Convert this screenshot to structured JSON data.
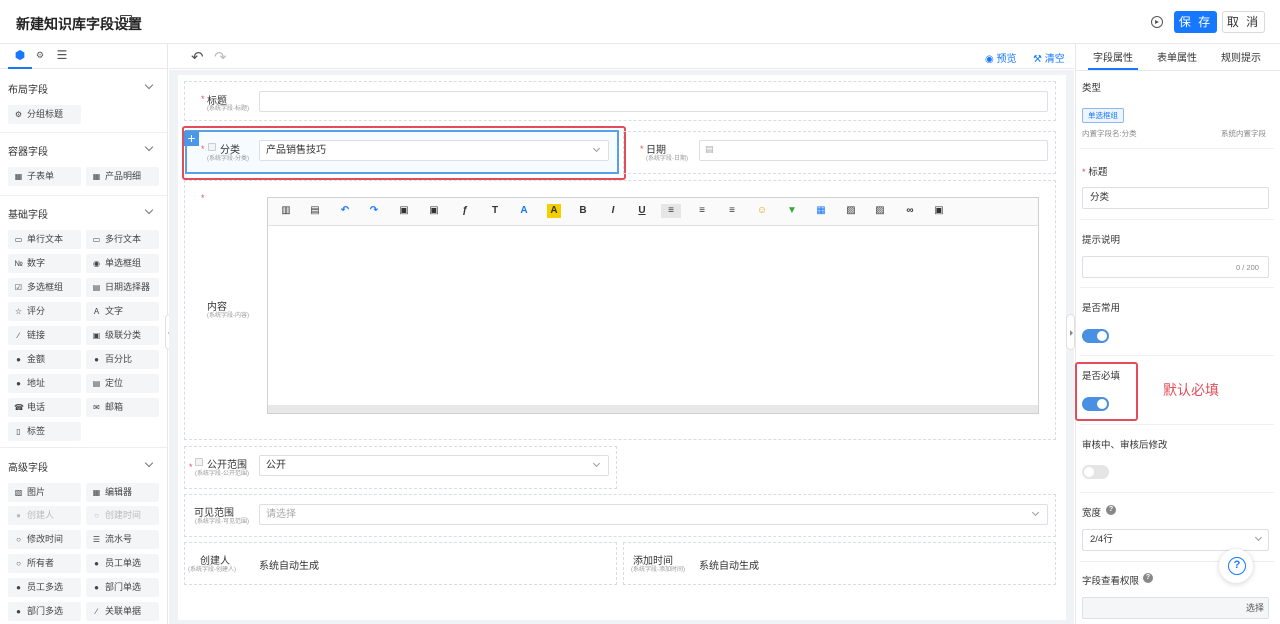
{
  "header": {
    "title": "新建知识库字段设置",
    "save_label": "保 存",
    "cancel_label": "取 消"
  },
  "left_panel": {
    "sections": [
      {
        "title": "布局字段",
        "items": [
          {
            "label": "分组标题",
            "icon": "group-title-icon"
          }
        ]
      },
      {
        "title": "容器字段",
        "items": [
          {
            "label": "子表单",
            "icon": "table-icon"
          },
          {
            "label": "产品明细",
            "icon": "table-icon"
          }
        ]
      },
      {
        "title": "基础字段",
        "items": [
          {
            "label": "单行文本",
            "icon": "single-line-icon"
          },
          {
            "label": "多行文本",
            "icon": "multi-line-icon"
          },
          {
            "label": "数字",
            "icon": "number-icon"
          },
          {
            "label": "单选框组",
            "icon": "radio-icon"
          },
          {
            "label": "多选框组",
            "icon": "checkbox-icon"
          },
          {
            "label": "日期选择器",
            "icon": "calendar-icon"
          },
          {
            "label": "评分",
            "icon": "star-icon"
          },
          {
            "label": "文字",
            "icon": "text-icon"
          },
          {
            "label": "链接",
            "icon": "link-icon"
          },
          {
            "label": "级联分类",
            "icon": "cascade-icon"
          },
          {
            "label": "金额",
            "icon": "money-icon"
          },
          {
            "label": "百分比",
            "icon": "percent-icon"
          },
          {
            "label": "地址",
            "icon": "location-icon"
          },
          {
            "label": "定位",
            "icon": "locate-icon"
          },
          {
            "label": "电话",
            "icon": "phone-icon"
          },
          {
            "label": "邮箱",
            "icon": "mail-icon"
          },
          {
            "label": "标签",
            "icon": "tag-icon"
          }
        ]
      },
      {
        "title": "高级字段",
        "items": [
          {
            "label": "图片",
            "icon": "image-icon"
          },
          {
            "label": "编辑器",
            "icon": "editor-icon"
          },
          {
            "label": "创建人",
            "icon": "user-icon",
            "disabled": true
          },
          {
            "label": "创建时间",
            "icon": "clock-icon",
            "disabled": true
          },
          {
            "label": "修改时间",
            "icon": "clock-icon"
          },
          {
            "label": "流水号",
            "icon": "list-icon"
          },
          {
            "label": "所有者",
            "icon": "clock-icon"
          },
          {
            "label": "员工单选",
            "icon": "user-icon"
          },
          {
            "label": "员工多选",
            "icon": "users-icon"
          },
          {
            "label": "部门单选",
            "icon": "user-icon"
          },
          {
            "label": "部门多选",
            "icon": "users-icon"
          },
          {
            "label": "关联单据",
            "icon": "link-icon"
          }
        ]
      }
    ]
  },
  "toolbar": {
    "preview_label": "预览",
    "clear_label": "清空"
  },
  "form": {
    "title_field": {
      "label": "标题",
      "sub": "(系统字段-标题)"
    },
    "category_field": {
      "label": "分类",
      "sub": "(系统字段-分类)",
      "value": "产品销售技巧"
    },
    "date_field": {
      "label": "日期",
      "sub": "(系统字段-日期)"
    },
    "content_field": {
      "label": "内容",
      "sub": "(系统字段-内容)"
    },
    "public_field": {
      "label": "公开范围",
      "sub": "(系统字段-公开范围)",
      "value": "公开"
    },
    "visible_field": {
      "label": "可见范围",
      "sub": "(系统字段-可见范围)",
      "placeholder": "请选择"
    },
    "creator_field": {
      "label": "创建人",
      "sub": "(系统字段-创建人)",
      "value": "系统自动生成"
    },
    "addtime_field": {
      "label": "添加时间",
      "sub": "(系统字段-添加时间)",
      "value": "系统自动生成"
    }
  },
  "editor_buttons": [
    "B",
    "I",
    "U"
  ],
  "right_panel": {
    "tabs": [
      "字段属性",
      "表单属性",
      "规则提示"
    ],
    "type_label": "类型",
    "type_tag": "单选框组",
    "builtin_name": "内置字段名:分类",
    "builtin_type": "系统内置字段",
    "title_label": "标题",
    "title_value": "分类",
    "hint_label": "提示说明",
    "hint_counter": "0 / 200",
    "common_label": "是否常用",
    "common_on": true,
    "required_label": "是否必填",
    "required_on": true,
    "edit_label": "审核中、审核后修改",
    "edit_on": false,
    "width_label": "宽度",
    "width_value": "2/4行",
    "perm_label": "字段查看权限",
    "perm_button": "选择"
  },
  "annotation": "默认必填",
  "colors": {
    "primary": "#1677ff",
    "danger": "#e34d59",
    "toggle": "#4a90e2"
  }
}
